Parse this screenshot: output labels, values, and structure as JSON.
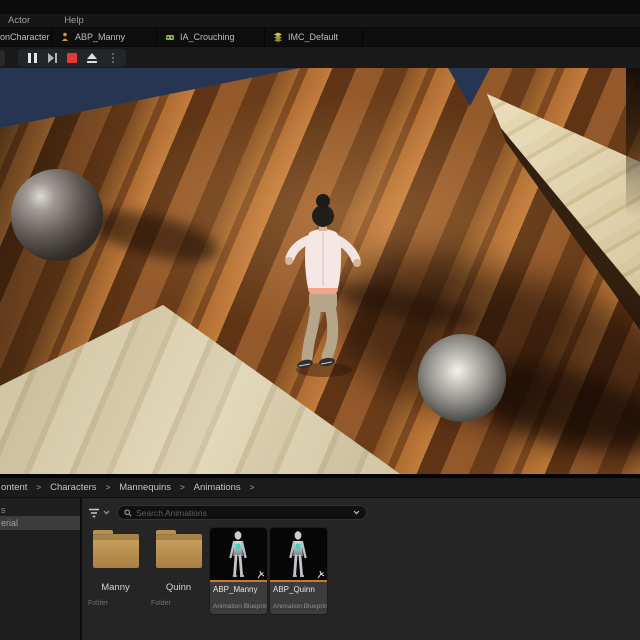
{
  "menubar": {
    "items": [
      {
        "label": "Actor"
      },
      {
        "label": "Help"
      }
    ]
  },
  "tabbar": {
    "tabs": [
      {
        "label": "onCharacter",
        "icon": null
      },
      {
        "label": "ABP_Manny",
        "icon": "animation-blueprint-icon",
        "icon_color": "#d8923c"
      },
      {
        "label": "IA_Crouching",
        "icon": "input-action-icon",
        "icon_color": "#84b548"
      },
      {
        "label": "IMC_Default",
        "icon": "input-mapping-context-icon",
        "icon_color": "#c2bd4a"
      }
    ]
  },
  "toolbar": {
    "buttons": [
      {
        "name": "pause"
      },
      {
        "name": "frame-skip"
      },
      {
        "name": "stop",
        "color": "#e23b33"
      },
      {
        "name": "eject"
      },
      {
        "name": "more-options"
      }
    ]
  },
  "viewport": {
    "scene_objects": [
      "wood-floor",
      "cream-platform",
      "right-wood-platform",
      "metal-sphere-left",
      "metal-sphere-right",
      "player-character"
    ],
    "sky_color": "#263552"
  },
  "breadcrumb": {
    "items": [
      "ontent",
      "Characters",
      "Mannequins",
      "Animations"
    ],
    "separator": ">"
  },
  "source_panel": {
    "rows": [
      {
        "label": "s",
        "selected": false
      },
      {
        "label": "erial",
        "selected": true
      }
    ]
  },
  "content_browser": {
    "search_placeholder": "Search Animations",
    "items": [
      {
        "name": "Manny",
        "type": "Folder"
      },
      {
        "name": "Quinn",
        "type": "Folder"
      },
      {
        "name": "ABP_Manny",
        "type": "Animation Blueprint"
      },
      {
        "name": "ABP_Quinn",
        "type": "Animation Blueprint"
      }
    ]
  },
  "colors": {
    "accent_orange": "#c7782a",
    "stop_red": "#e23b33",
    "sky": "#263552",
    "selection_row": "#3c3c3c"
  }
}
